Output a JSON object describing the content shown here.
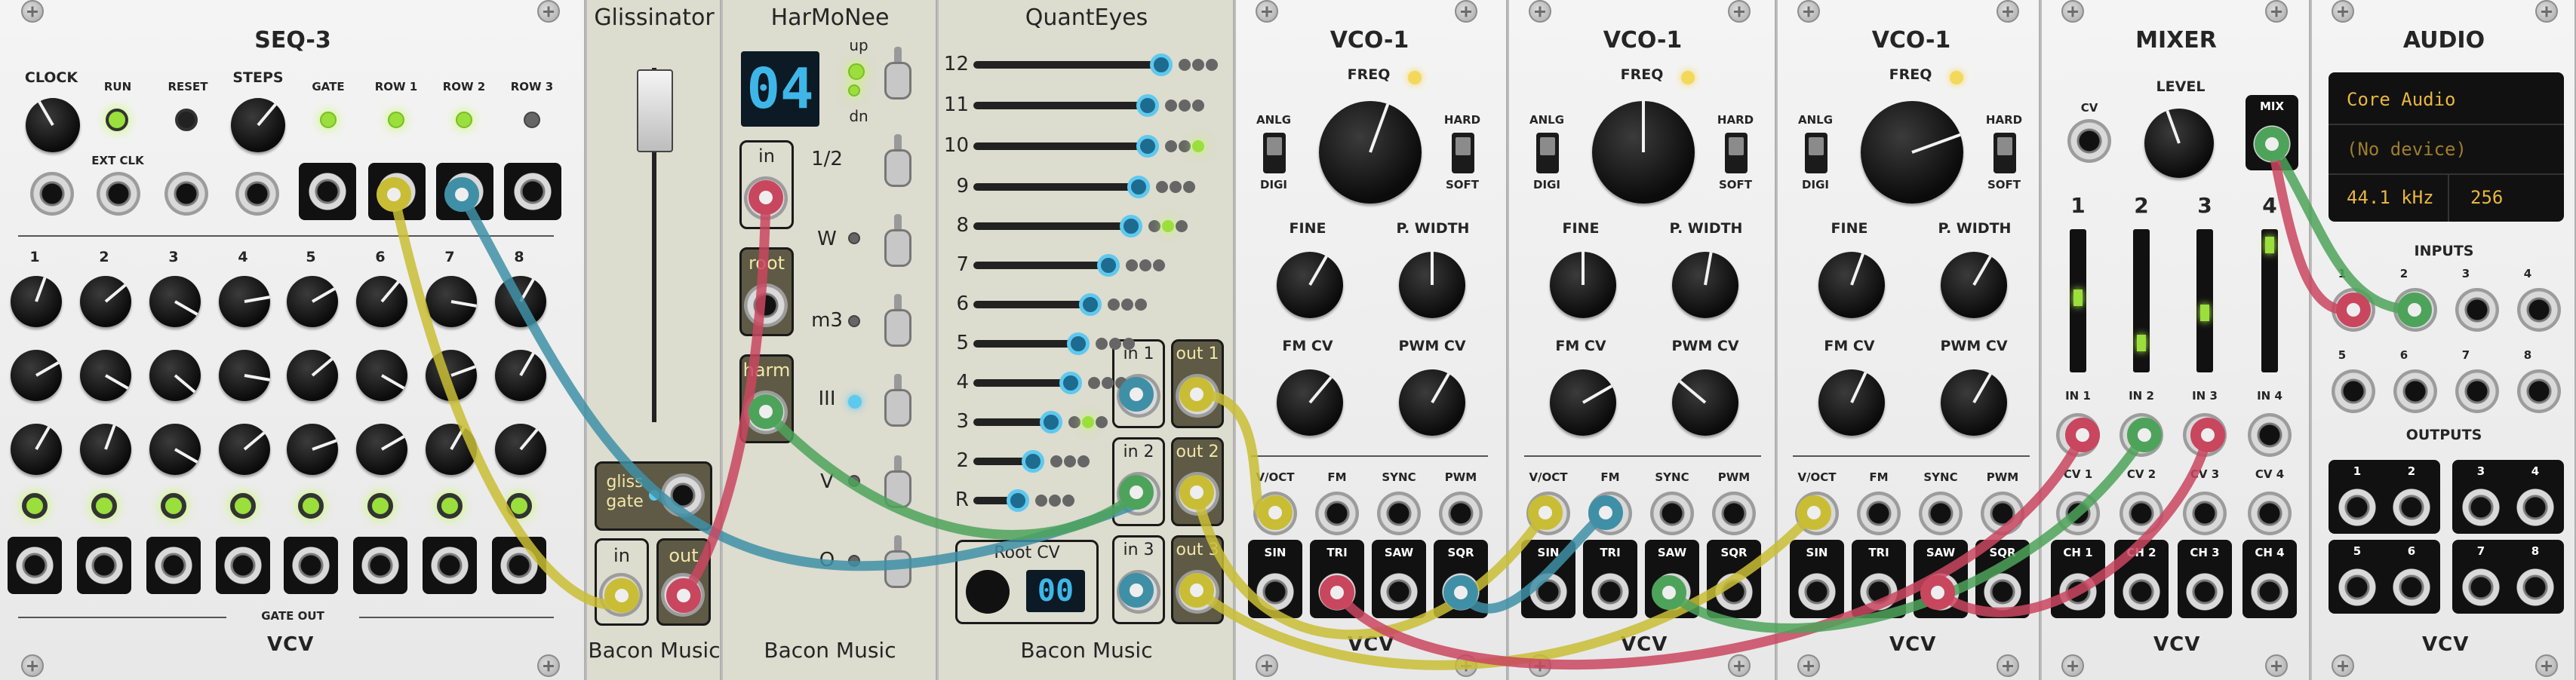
{
  "colors": {
    "cable_yellow": "#c9bd35",
    "cable_blue": "#3f90a6",
    "cable_green": "#4ea35b",
    "cable_red": "#c9465f",
    "led_green": "#9adf3c",
    "lcd_amber": "#e8b73e",
    "seg_blue": "#3fb6e8"
  },
  "seq3": {
    "title": "SEQ-3",
    "clock": "CLOCK",
    "run": "RUN",
    "reset": "RESET",
    "steps": "STEPS",
    "gate": "GATE",
    "row1": "ROW 1",
    "row2": "ROW 2",
    "row3": "ROW 3",
    "ext_clk": "EXT CLK",
    "step_numbers": [
      "1",
      "2",
      "3",
      "4",
      "5",
      "6",
      "7",
      "8"
    ],
    "gate_out": "GATE OUT",
    "logo": "VCV"
  },
  "gliss": {
    "title": "Glissinator",
    "gliss_gate": "gliss\ngate",
    "in": "in",
    "out": "out",
    "brand": "Bacon Music"
  },
  "harmonee": {
    "title": "HarMoNee",
    "display": "04",
    "up": "up",
    "dn": "dn",
    "half": "1/2",
    "w": "W",
    "m3": "m3",
    "iii": "III",
    "v": "V",
    "o": "O",
    "in": "in",
    "root": "root",
    "harm": "harm",
    "brand": "Bacon Music"
  },
  "quanteyes": {
    "title": "QuantEyes",
    "rows": [
      "12",
      "11",
      "10",
      "9",
      "8",
      "7",
      "6",
      "5",
      "4",
      "3",
      "2",
      "R"
    ],
    "in1": "in 1",
    "out1": "out 1",
    "in2": "in 2",
    "out2": "out 2",
    "in3": "in 3",
    "out3": "out 3",
    "root_cv": "Root CV",
    "root_display": "00",
    "brand": "Bacon Music"
  },
  "vco": [
    {
      "title": "VCO-1",
      "freq": "FREQ",
      "anlg": "ANLG",
      "digi": "DIGI",
      "hard": "HARD",
      "soft": "SOFT",
      "fine": "FINE",
      "pwidth": "P. WIDTH",
      "fmcv": "FM CV",
      "pwmcv": "PWM CV",
      "voct": "V/OCT",
      "fm": "FM",
      "sync": "SYNC",
      "pwm": "PWM",
      "sin": "SIN",
      "tri": "TRI",
      "saw": "SAW",
      "sqr": "SQR",
      "logo": "VCV"
    },
    {
      "title": "VCO-1",
      "freq": "FREQ",
      "anlg": "ANLG",
      "digi": "DIGI",
      "hard": "HARD",
      "soft": "SOFT",
      "fine": "FINE",
      "pwidth": "P. WIDTH",
      "fmcv": "FM CV",
      "pwmcv": "PWM CV",
      "voct": "V/OCT",
      "fm": "FM",
      "sync": "SYNC",
      "pwm": "PWM",
      "sin": "SIN",
      "tri": "TRI",
      "saw": "SAW",
      "sqr": "SQR",
      "logo": "VCV"
    },
    {
      "title": "VCO-1",
      "freq": "FREQ",
      "anlg": "ANLG",
      "digi": "DIGI",
      "hard": "HARD",
      "soft": "SOFT",
      "fine": "FINE",
      "pwidth": "P. WIDTH",
      "fmcv": "FM CV",
      "pwmcv": "PWM CV",
      "voct": "V/OCT",
      "fm": "FM",
      "sync": "SYNC",
      "pwm": "PWM",
      "sin": "SIN",
      "tri": "TRI",
      "saw": "SAW",
      "sqr": "SQR",
      "logo": "VCV"
    }
  ],
  "mixer": {
    "title": "MIXER",
    "cv": "CV",
    "level": "LEVEL",
    "mix": "MIX",
    "channels": [
      "1",
      "2",
      "3",
      "4"
    ],
    "in": [
      "IN 1",
      "IN 2",
      "IN 3",
      "IN 4"
    ],
    "cvs": [
      "CV 1",
      "CV 2",
      "CV 3",
      "CV 4"
    ],
    "ch": [
      "CH 1",
      "CH 2",
      "CH 3",
      "CH 4"
    ],
    "logo": "VCV"
  },
  "audio": {
    "title": "AUDIO",
    "driver": "Core Audio",
    "device": "(No device)",
    "rate": "44.1 kHz",
    "block": "256",
    "inputs": "INPUTS",
    "outputs": "OUTPUTS",
    "in_labels": [
      "1",
      "2",
      "3",
      "4",
      "5",
      "6",
      "7",
      "8"
    ],
    "out_labels": [
      "1",
      "2",
      "3",
      "4",
      "5",
      "6",
      "7",
      "8"
    ],
    "logo": "VCV"
  }
}
